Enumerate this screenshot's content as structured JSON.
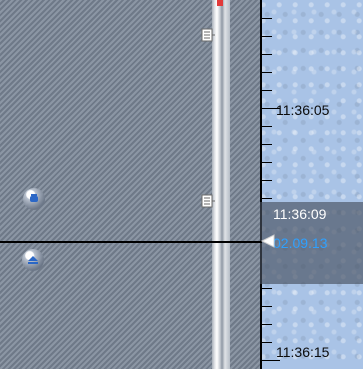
{
  "timeline": {
    "labels": [
      "11:36:05",
      "11:36:15"
    ],
    "current": {
      "time": "11:36:09",
      "date": "02.09.13"
    }
  },
  "colors": {
    "left_pane": "#7b8797",
    "timeline_bg": "#a9c3e6",
    "current_time_text": "#ffffff",
    "current_date_text": "#2ea1ff",
    "highlight_box": "#46505f"
  },
  "icons": {
    "top_marker": "bookmark-marker-icon",
    "mid_marker": "bookmark-marker-icon",
    "round_button_1": "record-button-icon",
    "round_button_2": "eject-button-icon",
    "cursor_arrow": "triangle-left-icon"
  }
}
